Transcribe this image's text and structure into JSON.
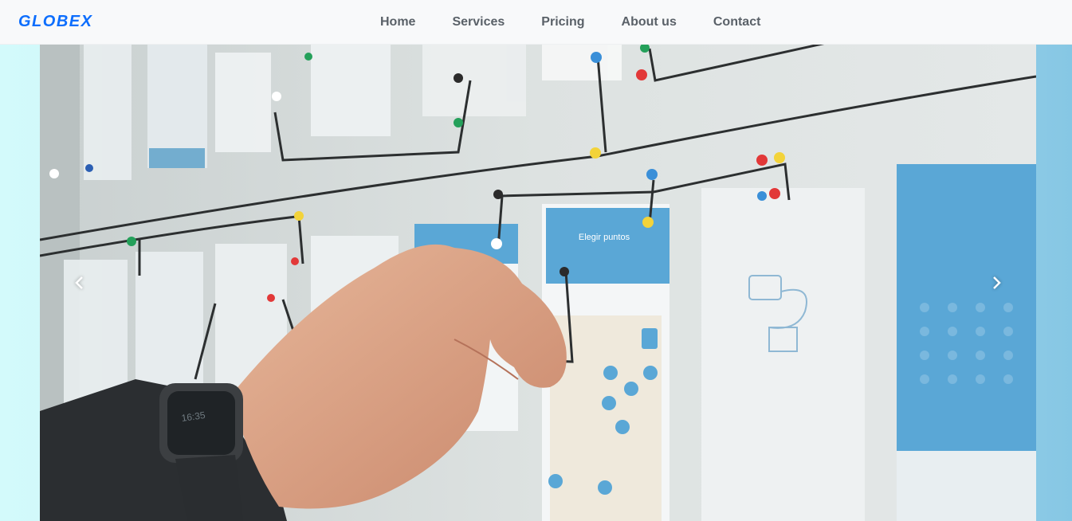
{
  "navbar": {
    "brand": "GLOBEX",
    "links": [
      "Home",
      "Services",
      "Pricing",
      "About us",
      "Contact"
    ]
  },
  "carousel": {
    "slide_image": "hand-pinning-string-on-wireframe-board",
    "prev_icon": "chevron-left-icon",
    "next_icon": "chevron-right-icon",
    "phone_screen_title": "Elegir puntos"
  },
  "colors": {
    "brand": "#0d6efd",
    "nav_text": "#5a6168",
    "navbar_bg": "#f8f9fa",
    "accent_blue": "#5aa7d6"
  }
}
